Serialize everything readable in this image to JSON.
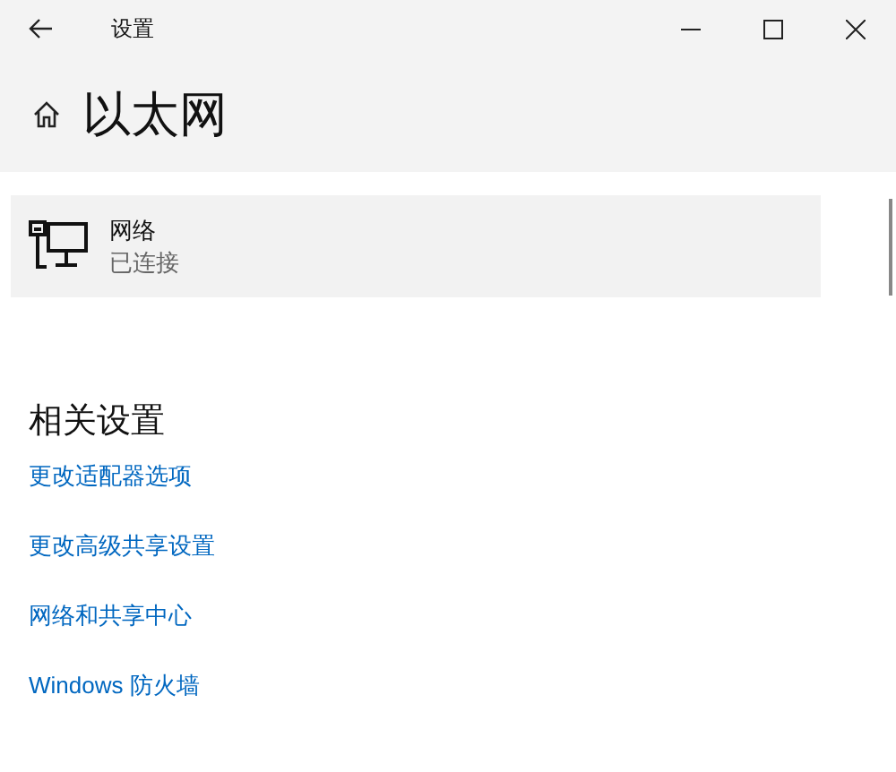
{
  "window": {
    "title": "设置"
  },
  "page": {
    "title": "以太网"
  },
  "network": {
    "name": "网络",
    "status": "已连接"
  },
  "related": {
    "heading": "相关设置",
    "links": [
      "更改适配器选项",
      "更改高级共享设置",
      "网络和共享中心",
      "Windows 防火墙"
    ]
  }
}
